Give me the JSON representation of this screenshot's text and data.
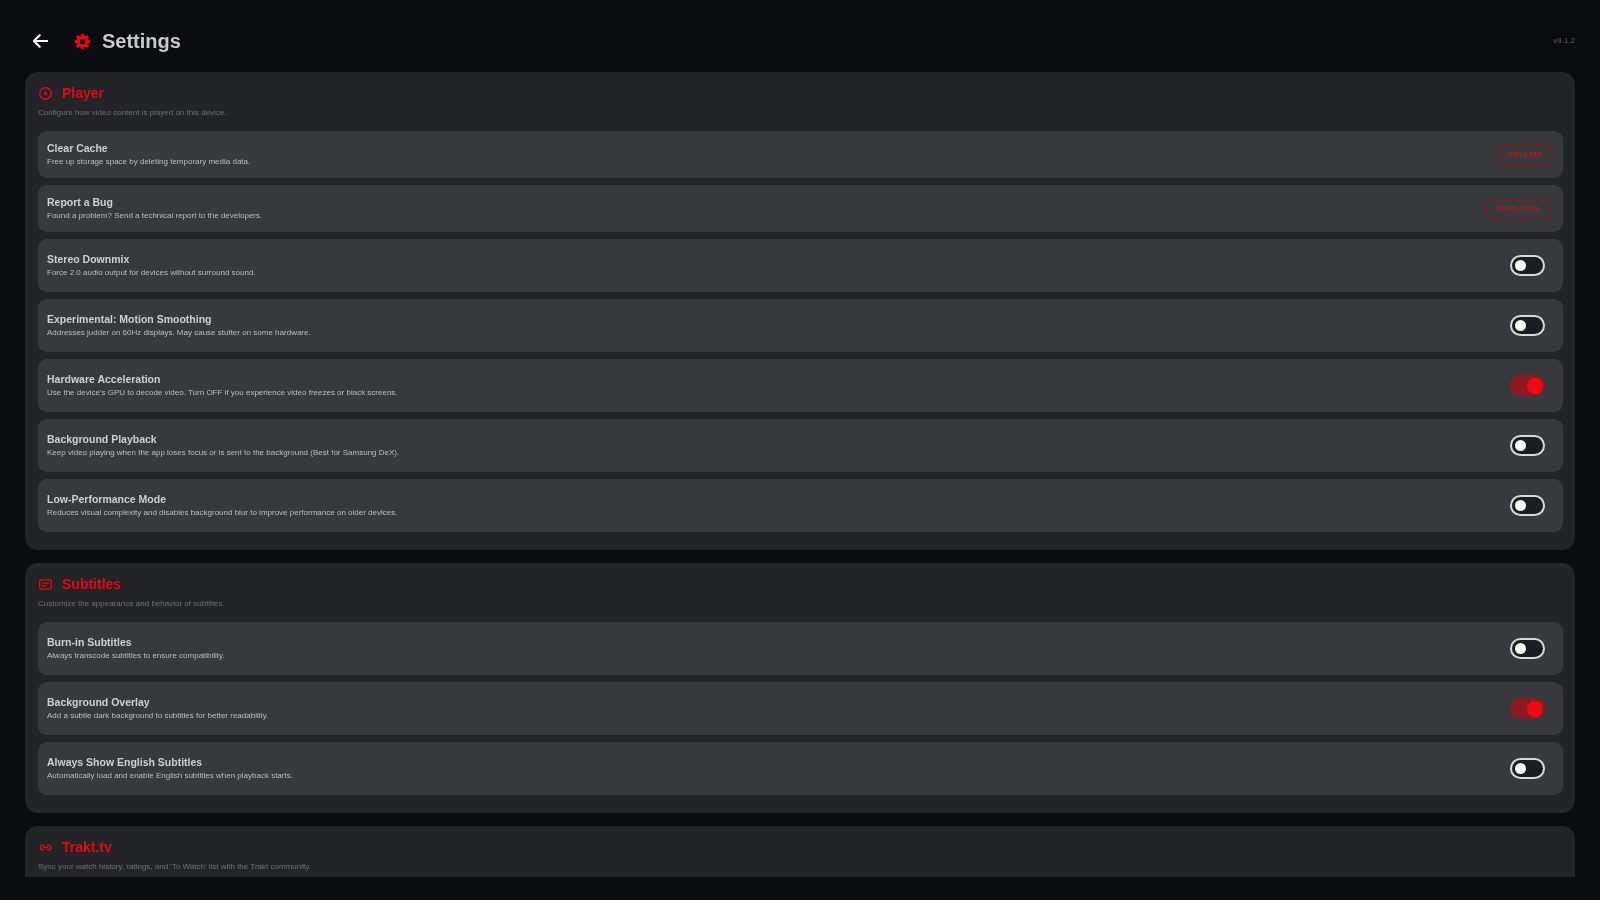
{
  "header": {
    "title": "Settings",
    "version": "v9.1.2"
  },
  "sections": [
    {
      "title": "Player",
      "description": "Configure how video content is played on this device.",
      "rows": [
        {
          "kind": "button",
          "title": "Clear Cache",
          "description": "Free up storage space by deleting temporary media data.",
          "action": "285.0 MB"
        },
        {
          "kind": "button",
          "title": "Report a Bug",
          "description": "Found a problem? Send a technical report to the developers.",
          "action": "OPEN TOOL"
        },
        {
          "kind": "toggle",
          "title": "Stereo Downmix",
          "description": "Force 2.0 audio output for devices without surround sound.",
          "on": false
        },
        {
          "kind": "toggle",
          "title": "Experimental: Motion Smoothing",
          "description": "Addresses judder on 60Hz displays. May cause stutter on some hardware.",
          "on": false
        },
        {
          "kind": "toggle",
          "title": "Hardware Acceleration",
          "description": "Use the device's GPU to decode video. Turn OFF if you experience video freezes or black screens.",
          "on": true
        },
        {
          "kind": "toggle",
          "title": "Background Playback",
          "description": "Keep video playing when the app loses focus or is sent to the background (Best for Samsung DeX).",
          "on": false
        },
        {
          "kind": "toggle",
          "title": "Low-Performance Mode",
          "description": "Reduces visual complexity and disables background blur to improve performance on older devices.",
          "on": false
        }
      ]
    },
    {
      "title": "Subtitles",
      "description": "Customize the appearance and behavior of subtitles.",
      "rows": [
        {
          "kind": "toggle",
          "title": "Burn-in Subtitles",
          "description": "Always transcode subtitles to ensure compatibility.",
          "on": false
        },
        {
          "kind": "toggle",
          "title": "Background Overlay",
          "description": "Add a subtle dark background to subtitles for better readability.",
          "on": true
        },
        {
          "kind": "toggle",
          "title": "Always Show English Subtitles",
          "description": "Automatically load and enable English subtitles when playback starts.",
          "on": false
        }
      ]
    },
    {
      "title": "Trakt.tv",
      "description": "Sync your watch history, ratings, and 'To Watch' list with the Trakt community."
    }
  ]
}
